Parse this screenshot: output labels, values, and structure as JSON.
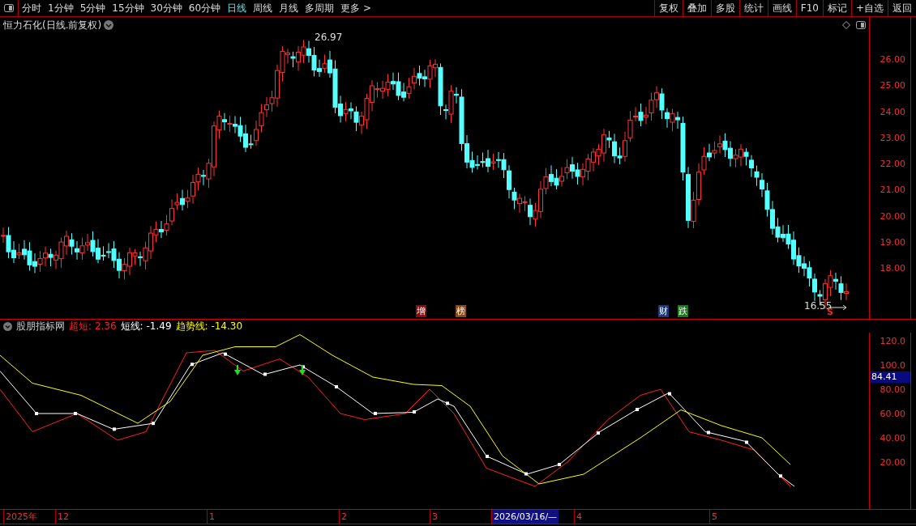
{
  "toolbar": {
    "periods": [
      {
        "label": "分时",
        "selected": false
      },
      {
        "label": "1分钟",
        "selected": false
      },
      {
        "label": "5分钟",
        "selected": false
      },
      {
        "label": "15分钟",
        "selected": false
      },
      {
        "label": "30分钟",
        "selected": false
      },
      {
        "label": "60分钟",
        "selected": false
      },
      {
        "label": "日线",
        "selected": true
      },
      {
        "label": "周线",
        "selected": false
      },
      {
        "label": "月线",
        "selected": false
      },
      {
        "label": "多周期",
        "selected": false
      },
      {
        "label": "更多 >",
        "selected": false
      }
    ],
    "actions": [
      "复权",
      "叠加",
      "多股",
      "统计",
      "画线",
      "F10",
      "标记",
      "+自选",
      "返回"
    ]
  },
  "main_chart": {
    "title": "恒力石化(日线.前复权)",
    "high_label": "26.97",
    "low_label": "16.55",
    "signal_mark": "S",
    "yticks": [
      "26.00",
      "25.00",
      "24.00",
      "23.00",
      "22.00",
      "21.00",
      "20.00",
      "19.00",
      "18.00"
    ],
    "event_tags": [
      {
        "label": "增",
        "color": "#8b0a0a"
      },
      {
        "label": "榜",
        "color": "#8b4a14"
      },
      {
        "label": "财",
        "color": "#1c3a78"
      },
      {
        "label": "跌",
        "color": "#1a7a1a"
      }
    ]
  },
  "indicator": {
    "name": "股朋指标网",
    "cursor_value": "84.41",
    "lines": [
      {
        "label": "超短:",
        "value": "2.36",
        "color": "#ff2020"
      },
      {
        "label": "短线:",
        "value": "-1.49",
        "color": "#ffffff"
      },
      {
        "label": "趋势线:",
        "value": "-14.30",
        "color": "#ffff00"
      }
    ],
    "yticks": [
      "120.0",
      "100.0",
      "80.00",
      "60.00",
      "40.00",
      "20.00"
    ]
  },
  "time_axis": {
    "labels": [
      {
        "label": "2025年",
        "selected": false
      },
      {
        "label": "12",
        "selected": false
      },
      {
        "label": "1",
        "selected": false
      },
      {
        "label": "2",
        "selected": false
      },
      {
        "label": "3",
        "selected": false
      },
      {
        "label": "2026/03/16/—",
        "selected": true
      },
      {
        "label": "4",
        "selected": false
      },
      {
        "label": "5",
        "selected": false
      }
    ]
  }
}
